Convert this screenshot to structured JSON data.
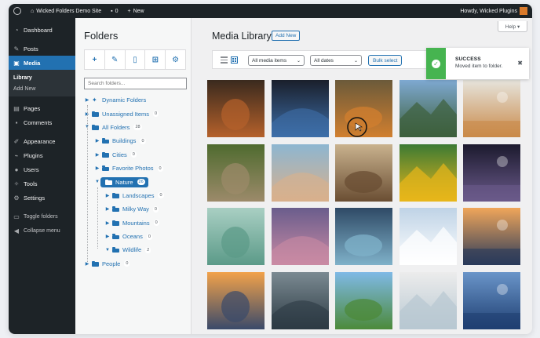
{
  "adminbar": {
    "site_name": "Wicked Folders Demo Site",
    "comments_count": "0",
    "new_label": "New",
    "howdy": "Howdy, Wicked Plugins"
  },
  "sidebar": {
    "items": [
      {
        "label": "Dashboard",
        "icon": "dashboard-icon"
      },
      {
        "label": "Posts",
        "icon": "pin-icon"
      },
      {
        "label": "Media",
        "icon": "media-icon",
        "active": true
      }
    ],
    "media_submenu": [
      "Library",
      "Add New"
    ],
    "items2": [
      {
        "label": "Pages",
        "icon": "page-icon"
      },
      {
        "label": "Comments",
        "icon": "comment-icon"
      }
    ],
    "items3": [
      {
        "label": "Appearance",
        "icon": "brush-icon"
      },
      {
        "label": "Plugins",
        "icon": "plug-icon"
      },
      {
        "label": "Users",
        "icon": "user-icon"
      },
      {
        "label": "Tools",
        "icon": "wrench-icon"
      },
      {
        "label": "Settings",
        "icon": "settings-icon"
      }
    ],
    "toggle_folders": "Toggle folders",
    "collapse_menu": "Collapse menu"
  },
  "folders": {
    "title": "Folders",
    "search_placeholder": "Search folders...",
    "tree": [
      {
        "label": "Dynamic Folders",
        "depth": 0,
        "arrow": "right",
        "icon": "dynamic"
      },
      {
        "label": "Unassigned Items",
        "depth": 0,
        "arrow": "right",
        "count": "0"
      },
      {
        "label": "All Folders",
        "depth": 0,
        "arrow": "down",
        "count": "28"
      },
      {
        "label": "Buildings",
        "depth": 1,
        "arrow": "right",
        "count": "0"
      },
      {
        "label": "Cities",
        "depth": 1,
        "arrow": "right",
        "count": "0"
      },
      {
        "label": "Favorite Photos",
        "depth": 1,
        "arrow": "right",
        "count": "0"
      },
      {
        "label": "Nature",
        "depth": 1,
        "arrow": "down",
        "count": "26",
        "selected": true
      },
      {
        "label": "Landscapes",
        "depth": 2,
        "arrow": "right",
        "count": "0"
      },
      {
        "label": "Milky Way",
        "depth": 2,
        "arrow": "right",
        "count": "0"
      },
      {
        "label": "Mountains",
        "depth": 2,
        "arrow": "right",
        "count": "0"
      },
      {
        "label": "Oceans",
        "depth": 2,
        "arrow": "right",
        "count": "0"
      },
      {
        "label": "Wildlife",
        "depth": 2,
        "arrow": "down",
        "count": "2"
      },
      {
        "label": "People",
        "depth": 0,
        "arrow": "right",
        "count": "0"
      }
    ]
  },
  "main": {
    "help_label": "Help ▾",
    "title": "Media Library",
    "add_new": "Add New",
    "filter_type": "All media items",
    "filter_date": "All dates",
    "bulk_select": "Bulk select"
  },
  "toast": {
    "title": "SUCCESS",
    "message": "Moved item to folder."
  },
  "thumbnails": [
    {
      "name": "fox",
      "colors": [
        "#3a2a1e",
        "#b5612b"
      ]
    },
    {
      "name": "abstract-blue",
      "colors": [
        "#1a1f2b",
        "#3d6ea8"
      ]
    },
    {
      "name": "tiger",
      "colors": [
        "#6b5a3a",
        "#d17f2f"
      ]
    },
    {
      "name": "mountain-lake",
      "colors": [
        "#7ea9d1",
        "#3d5f3c"
      ]
    },
    {
      "name": "field-flowers",
      "colors": [
        "#e6e4dc",
        "#c98a4a"
      ]
    },
    {
      "name": "owl",
      "colors": [
        "#4f6b2f",
        "#9c8a6a"
      ]
    },
    {
      "name": "desert-dune",
      "colors": [
        "#8db6d1",
        "#d9b08c"
      ]
    },
    {
      "name": "elephant",
      "colors": [
        "#c9b28e",
        "#6a4e33"
      ]
    },
    {
      "name": "sunflower",
      "colors": [
        "#3c7a34",
        "#e8b61a"
      ]
    },
    {
      "name": "milky-way",
      "colors": [
        "#1c1a2e",
        "#6a5a8a"
      ]
    },
    {
      "name": "misty-bird",
      "colors": [
        "#a9cfc3",
        "#5b9a88"
      ]
    },
    {
      "name": "purple-sky",
      "colors": [
        "#6a5d8c",
        "#c98aa4"
      ]
    },
    {
      "name": "tree-canopy",
      "colors": [
        "#2f4a66",
        "#7fb1c9"
      ]
    },
    {
      "name": "snow-peaks",
      "colors": [
        "#bfd3e6",
        "#ffffff"
      ]
    },
    {
      "name": "forest-sunset",
      "colors": [
        "#f0a65a",
        "#2a3a5a"
      ]
    },
    {
      "name": "sunset-mountains",
      "colors": [
        "#f2a24a",
        "#3a4a6a"
      ]
    },
    {
      "name": "fog-valley",
      "colors": [
        "#7b8a92",
        "#2d3b44"
      ]
    },
    {
      "name": "lone-tree",
      "colors": [
        "#7fb9e6",
        "#4c8a3a"
      ]
    },
    {
      "name": "statue-fog",
      "colors": [
        "#ececec",
        "#b8c8d2"
      ]
    },
    {
      "name": "blue-hills",
      "colors": [
        "#6a95c9",
        "#1f3f72"
      ]
    }
  ]
}
